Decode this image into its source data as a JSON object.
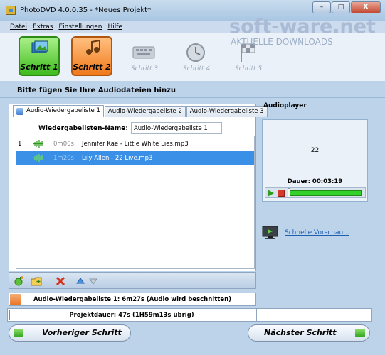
{
  "window": {
    "title": "PhotoDVD 4.0.0.35 - *Neues Projekt*"
  },
  "window_buttons": {
    "minimize": "–",
    "maximize": "□",
    "close": "X"
  },
  "menu": [
    "Datei",
    "Extras",
    "Einstellungen",
    "Hilfe"
  ],
  "watermark": {
    "logo": "soft-ware.net",
    "tagline": "AKTUELLE DOWNLOADS"
  },
  "steps": [
    {
      "label": "Schritt 1",
      "state": "active-green",
      "icon": "photo-icon"
    },
    {
      "label": "Schritt 2",
      "state": "active-orange",
      "icon": "music-note-icon"
    },
    {
      "label": "Schritt 3",
      "state": "disabled",
      "icon": "keyboard-icon"
    },
    {
      "label": "Schritt 4",
      "state": "disabled",
      "icon": "clock-icon"
    },
    {
      "label": "Schritt 5",
      "state": "disabled",
      "icon": "flag-icon"
    }
  ],
  "instruction": "Bitte fügen Sie Ihre Audiodateien hinzu",
  "tabs": [
    "Audio-Wiedergabeliste 1",
    "Audio-Wiedergabeliste 2",
    "Audio-Wiedergabeliste 3"
  ],
  "playlist_name": {
    "label": "Wiedergabelisten-Name:",
    "value": "Audio-Wiedergabeliste 1"
  },
  "tracks": [
    {
      "number": "1",
      "time": "0m00s",
      "name": "Jennifer Kae - Little White Lies.mp3",
      "selected": false
    },
    {
      "number": "",
      "time": "1m20s",
      "name": "Lily Allen - 22 Live.mp3",
      "selected": true
    }
  ],
  "playlist_status": "Audio-Wiedergabeliste 1: 6m27s (Audio wird beschnitten)",
  "project_duration": "Projektdauer: 47s (1H59m13s übrig)",
  "player": {
    "title": "Audioplayer",
    "track_number": "22",
    "duration": "Dauer: 00:03:19",
    "position_fraction": 0.0
  },
  "preview_link": "Schnelle Vorschau...",
  "nav": {
    "prev": "Vorheriger Schritt",
    "next": "Nächster Schritt"
  },
  "colors": {
    "accent_green": "#3fbb1e",
    "accent_orange": "#f07a1c",
    "selection": "#3a8fe6",
    "link": "#1e5fb3"
  }
}
